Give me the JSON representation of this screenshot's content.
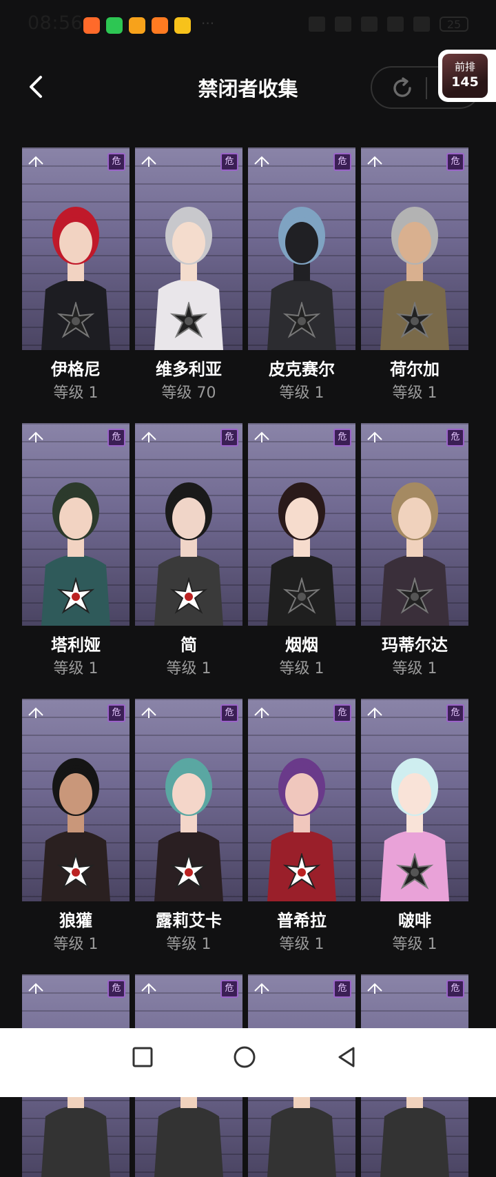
{
  "status_bar": {
    "time": "08:56",
    "battery": "25",
    "app_icon_colors": [
      "#ff6a2a",
      "#2dc653",
      "#f7a21b",
      "#ff7b21",
      "#f7c21b"
    ]
  },
  "header": {
    "title": "禁闭者收集",
    "back_icon": "chevron-left-icon",
    "refresh_icon": "refresh-icon"
  },
  "rank": {
    "label": "前排",
    "value": "145"
  },
  "characters": [
    {
      "name": "伊格尼",
      "level": "等级 1",
      "hair": "#c0192a",
      "skin": "#f2d3c2",
      "outfit": "#1d1d22",
      "emblem": "dark"
    },
    {
      "name": "维多利亚",
      "level": "等级 70",
      "hair": "#c8c8cc",
      "skin": "#f4dccd",
      "outfit": "#e9e6ea",
      "emblem": "dark"
    },
    {
      "name": "皮克赛尔",
      "level": "等级 1",
      "hair": "#7fa3c2",
      "skin": "#202024",
      "outfit": "#2c2c30",
      "emblem": "dark"
    },
    {
      "name": "荷尔加",
      "level": "等级 1",
      "hair": "#b3b3b3",
      "skin": "#d9b08f",
      "outfit": "#7a6a4a",
      "emblem": "dark"
    },
    {
      "name": "塔利娅",
      "level": "等级 1",
      "hair": "#2c3a2c",
      "skin": "#f2d3c2",
      "outfit": "#2f5a5a",
      "emblem": "light"
    },
    {
      "name": "简",
      "level": "等级 1",
      "hair": "#1a1a1a",
      "skin": "#f0d5c8",
      "outfit": "#3a3a3a",
      "emblem": "light"
    },
    {
      "name": "烟烟",
      "level": "等级 1",
      "hair": "#2a1a1a",
      "skin": "#f6dccd",
      "outfit": "#1f1f1f",
      "emblem": "dark"
    },
    {
      "name": "玛蒂尔达",
      "level": "等级 1",
      "hair": "#a58a62",
      "skin": "#f0d2bd",
      "outfit": "#3a2f3a",
      "emblem": "dark"
    },
    {
      "name": "狼獾",
      "level": "等级 1",
      "hair": "#151515",
      "skin": "#c9977a",
      "outfit": "#2a2020",
      "emblem": "light"
    },
    {
      "name": "露莉艾卡",
      "level": "等级 1",
      "hair": "#5aa7a2",
      "skin": "#f4d6c9",
      "outfit": "#2a1f22",
      "emblem": "light"
    },
    {
      "name": "普希拉",
      "level": "等级 1",
      "hair": "#6a3a8a",
      "skin": "#f0c7bd",
      "outfit": "#9a1f2a",
      "emblem": "light"
    },
    {
      "name": "啵啡",
      "level": "等级 1",
      "hair": "#cfeef0",
      "skin": "#f9e3d8",
      "outfit": "#e9a2d8",
      "emblem": "dark"
    },
    {
      "name": "",
      "level": "",
      "hair": "#e8b43a",
      "skin": "#f0d2bd",
      "outfit": "#333",
      "emblem": "none"
    },
    {
      "name": "",
      "level": "",
      "hair": "#1a1a1a",
      "skin": "#f0d2bd",
      "outfit": "#333",
      "emblem": "none"
    },
    {
      "name": "",
      "level": "",
      "hair": "#6aa9c9",
      "skin": "#f0d2bd",
      "outfit": "#333",
      "emblem": "none"
    },
    {
      "name": "",
      "level": "",
      "hair": "#4a2a4a",
      "skin": "#f0d2bd",
      "outfit": "#333",
      "emblem": "none"
    }
  ],
  "nav": {
    "recents_icon": "square-icon",
    "home_icon": "circle-icon",
    "back_icon": "triangle-back-icon"
  }
}
